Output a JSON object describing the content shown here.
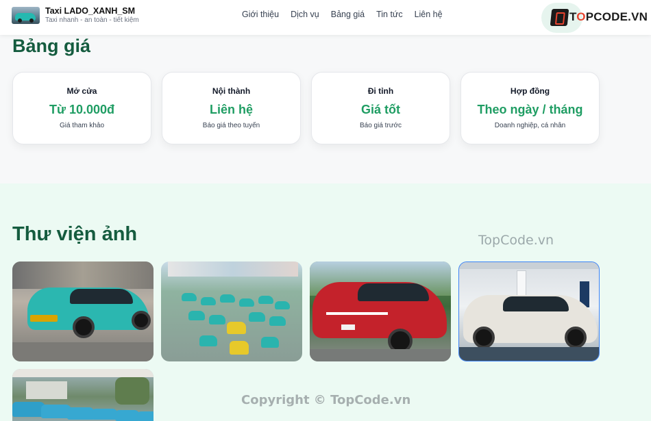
{
  "header": {
    "brand_name": "Taxi LADO_XANH_SM",
    "brand_tagline": "Taxi nhanh - an toàn - tiết kiệm",
    "nav": [
      "Giới thiệu",
      "Dịch vụ",
      "Bảng giá",
      "Tin tức",
      "Liên hệ"
    ],
    "logo_text_prefix": "T",
    "logo_text_o": "O",
    "logo_text_suffix": "PCODE.VN"
  },
  "pricing": {
    "title": "Bảng giá",
    "cards": [
      {
        "title": "Mở cửa",
        "value": "Từ 10.000đ",
        "note": "Giá tham khảo"
      },
      {
        "title": "Nội thành",
        "value": "Liên hệ",
        "note": "Báo giá theo tuyến"
      },
      {
        "title": "Đi tỉnh",
        "value": "Giá tốt",
        "note": "Báo giá trước"
      },
      {
        "title": "Hợp đồng",
        "value": "Theo ngày / tháng",
        "note": "Doanh nghiệp, cá nhân"
      }
    ]
  },
  "gallery": {
    "title": "Thư viện ảnh",
    "photos": [
      "teal-taxi-car-photo",
      "taxi-fleet-aerial-photo",
      "red-vf7-car-photo",
      "white-car-showroom-photo",
      "taxi-row-parking-photo"
    ]
  },
  "watermarks": {
    "top": "TopCode.vn",
    "bottom": "Copyright © TopCode.vn"
  },
  "colors": {
    "primary_green": "#155c3f",
    "accent_green": "#1f9d63",
    "gallery_bg": "#ecfaf3"
  }
}
